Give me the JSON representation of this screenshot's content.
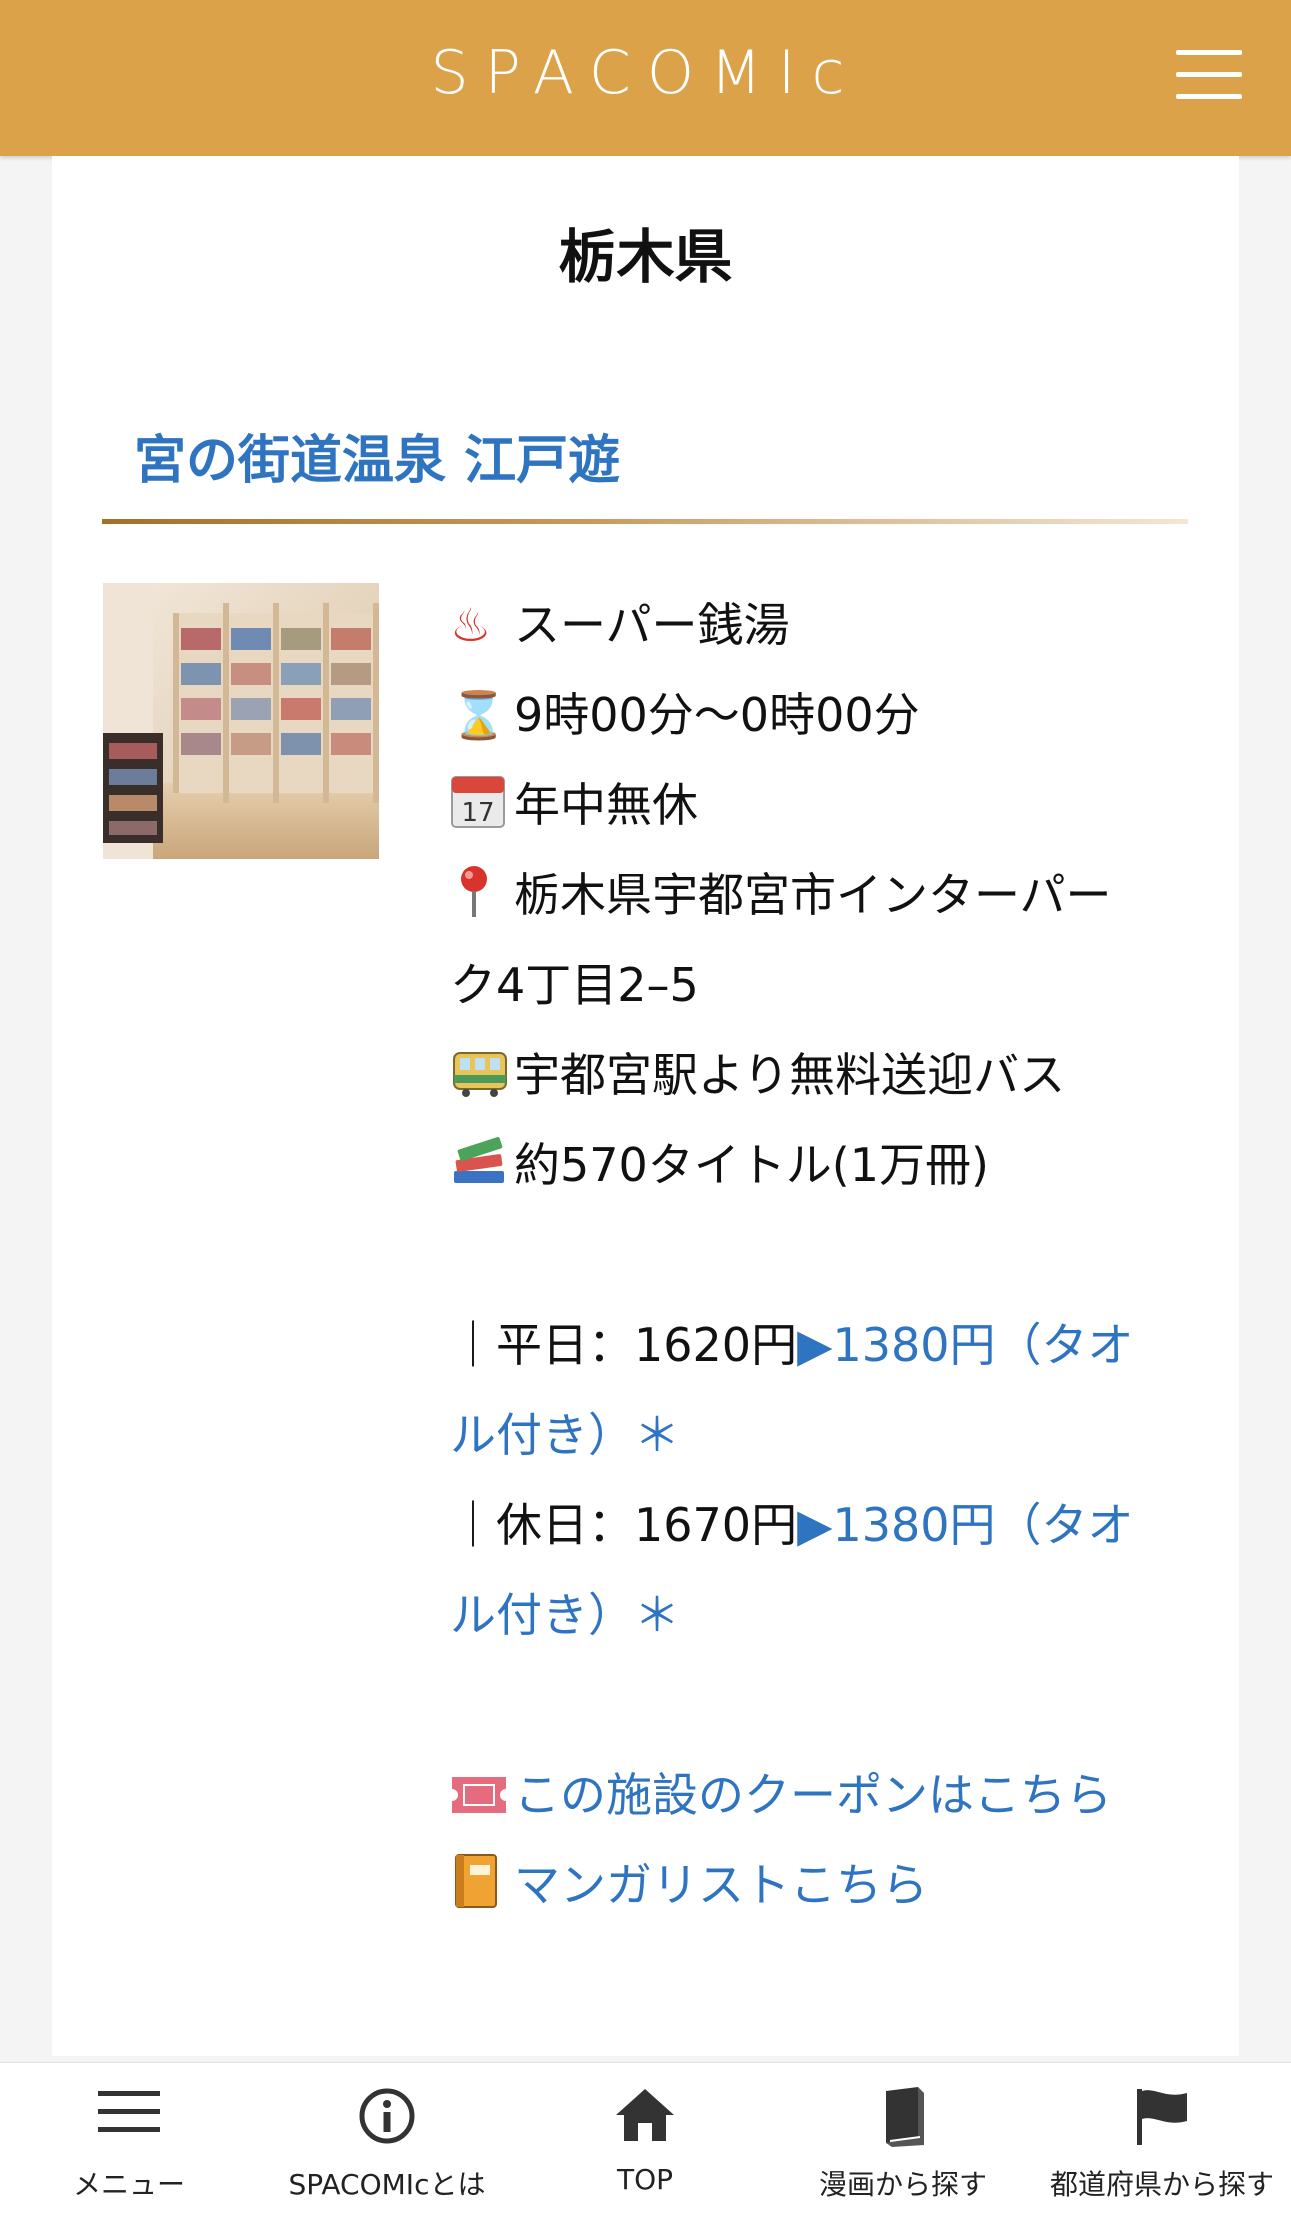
{
  "header": {
    "logo": "SPACOMIc",
    "menu_icon": "hamburger-icon"
  },
  "page": {
    "title": "栃木県"
  },
  "facility": {
    "name": "宮の街道温泉 江戸遊",
    "type": {
      "icon": "♨",
      "text": "スーパー銭湯"
    },
    "hours": {
      "icon": "⌛",
      "text": "9時00分〜0時00分"
    },
    "holiday": {
      "icon": "calendar-icon",
      "text": "年中無休"
    },
    "address": {
      "icon": "pin-icon",
      "line1": "栃木県宇都宮市インターパー",
      "line2": "ク4丁目2–5"
    },
    "access": {
      "icon": "tram-icon",
      "text": "宇都宮駅より無料送迎バス"
    },
    "titles": {
      "icon": "books-icon",
      "text": "約570タイトル(1万冊)"
    },
    "prices": [
      {
        "prefix": "｜平日：",
        "regular": "1620円",
        "arrow": "▶",
        "discount": "1380円（タオ",
        "discount_cont": "ル付き）＊"
      },
      {
        "prefix": "｜休日：",
        "regular": "1670円",
        "arrow": "▶",
        "discount": "1380円（タオ",
        "discount_cont": "ル付き）＊"
      }
    ],
    "coupon_link": {
      "icon": "ticket-icon",
      "text": "この施設のクーポンはこちら"
    },
    "manga_link": {
      "icon": "notebook-icon",
      "text": "マンガリストこちら"
    }
  },
  "bottom_nav": {
    "items": [
      {
        "label": "メニュー",
        "icon": "menu-icon"
      },
      {
        "label": "SPACOMIcとは",
        "icon": "info-icon"
      },
      {
        "label": "TOP",
        "icon": "home-icon"
      },
      {
        "label": "漫画から探す",
        "icon": "book-icon"
      },
      {
        "label": "都道府県から探す",
        "icon": "flag-icon"
      }
    ]
  },
  "colors": {
    "header": "#dca24a",
    "link": "#2f74c0",
    "background": "#f4f4f4"
  }
}
